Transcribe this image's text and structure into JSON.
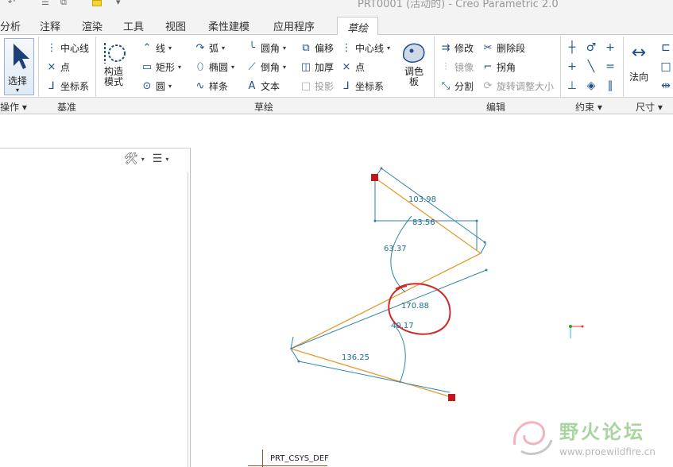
{
  "window": {
    "title": "PRT0001 (活动的) - Creo Parametric 2.0"
  },
  "tabs": [
    {
      "label": "分析"
    },
    {
      "label": "注释"
    },
    {
      "label": "渲染"
    },
    {
      "label": "工具"
    },
    {
      "label": "视图"
    },
    {
      "label": "柔性建模"
    },
    {
      "label": "应用程序"
    },
    {
      "label": "草绘"
    }
  ],
  "ribbon": {
    "select": {
      "label": "选择"
    },
    "datum": {
      "centerline": "中心线",
      "point": "点",
      "csys": "坐标系"
    },
    "construction": {
      "label1": "构造",
      "label2": "模式"
    },
    "sketch": {
      "line": "线",
      "rectangle": "矩形",
      "circle": "圆",
      "arc": "弧",
      "ellipse": "椭圆",
      "spline": "样条",
      "fillet": "圆角",
      "chamfer": "倒角",
      "text": "文本",
      "offset": "偏移",
      "thicken": "加厚",
      "project": "投影",
      "centerline": "中心线",
      "point": "点",
      "csys": "坐标系",
      "palette1": "调色",
      "palette2": "板"
    },
    "edit": {
      "modify": "修改",
      "delete_segment": "删除段",
      "mirror": "镜像",
      "corner": "拐角",
      "divide": "分割",
      "rotate_resize": "旋转调整大小"
    },
    "dim": {
      "normal": "法向"
    },
    "groups": {
      "operations": "操作",
      "datum": "基准",
      "sketch": "草绘",
      "edit": "编辑",
      "constrain": "约束",
      "dimension": "尺寸"
    }
  },
  "sketch": {
    "dimensions": [
      "103.98",
      "83.56",
      "63.37",
      "170.88",
      "40.17",
      "136.25"
    ],
    "csys_label": "PRT_CSYS_DEF",
    "colors": {
      "geometry": "#e39a2e",
      "dimension": "#2f86a8",
      "endpoint": "#c0171c",
      "annotation": "#cf2a2a"
    }
  },
  "watermark": {
    "title": "野火论坛",
    "url": "www.proewildfire.cn"
  }
}
